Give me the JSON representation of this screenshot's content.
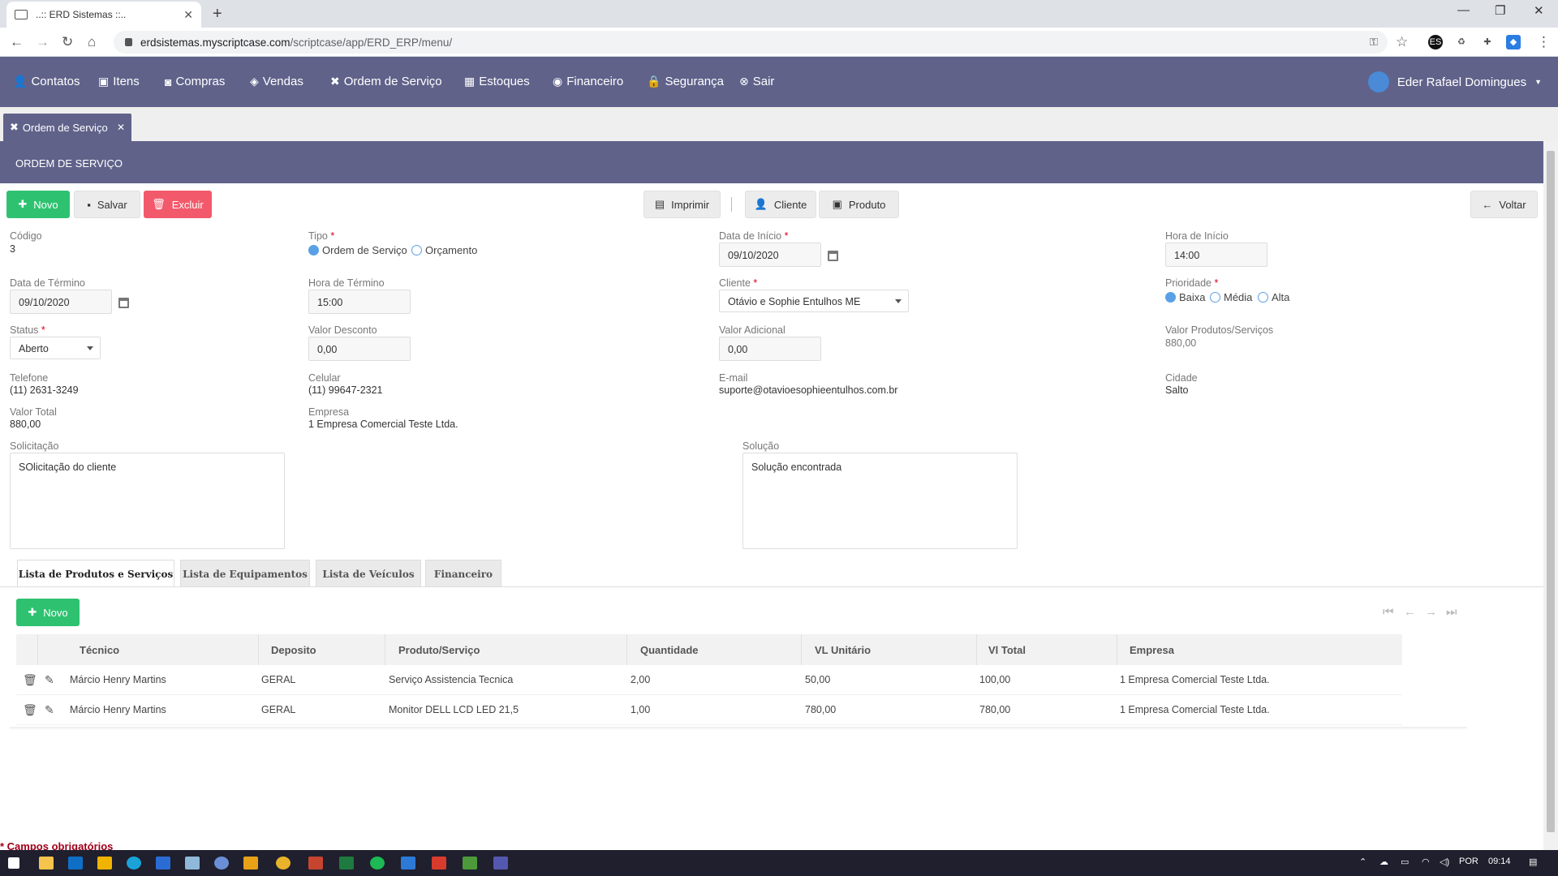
{
  "browser": {
    "tab_title": "..:: ERD Sistemas ::..",
    "url_host": "erdsistemas.myscriptcase.com",
    "url_path": "/scriptcase/app/ERD_ERP/menu/"
  },
  "nav": {
    "items": [
      "Contatos",
      "Itens",
      "Compras",
      "Vendas",
      "Ordem de Serviço",
      "Estoques",
      "Financeiro",
      "Segurança",
      "Sair"
    ],
    "user": "Eder Rafael Domingues"
  },
  "page_tab": {
    "label": "Ordem de Serviço"
  },
  "section_title": "ORDEM DE SERVIÇO",
  "toolbar": {
    "novo": "Novo",
    "salvar": "Salvar",
    "excluir": "Excluir",
    "imprimir": "Imprimir",
    "cliente": "Cliente",
    "produto": "Produto",
    "voltar": "Voltar"
  },
  "form": {
    "codigo_label": "Código",
    "codigo": "3",
    "tipo_label": "Tipo",
    "tipo_options": [
      "Ordem de Serviço",
      "Orçamento"
    ],
    "tipo_selected": "Ordem de Serviço",
    "data_inicio_label": "Data de Início",
    "data_inicio": "09/10/2020",
    "hora_inicio_label": "Hora de Início",
    "hora_inicio": "14:00",
    "data_termino_label": "Data de Término",
    "data_termino": "09/10/2020",
    "hora_termino_label": "Hora de Término",
    "hora_termino": "15:00",
    "cliente_label": "Cliente",
    "cliente": "Otávio e Sophie Entulhos ME",
    "prioridade_label": "Prioridade",
    "prioridade_options": [
      "Baixa",
      "Média",
      "Alta"
    ],
    "prioridade_selected": "Baixa",
    "status_label": "Status",
    "status": "Aberto",
    "valor_desconto_label": "Valor Desconto",
    "valor_desconto": "0,00",
    "valor_adicional_label": "Valor Adicional",
    "valor_adicional": "0,00",
    "valor_produtos_label": "Valor Produtos/Serviços",
    "valor_produtos": "880,00",
    "telefone_label": "Telefone",
    "telefone": "(11) 2631-3249",
    "celular_label": "Celular",
    "celular": "(11) 99647-2321",
    "email_label": "E-mail",
    "email": "suporte@otavioesophieentulhos.com.br",
    "cidade_label": "Cidade",
    "cidade": "Salto",
    "valor_total_label": "Valor Total",
    "valor_total": "880,00",
    "empresa_label": "Empresa",
    "empresa": "1 Empresa Comercial Teste Ltda.",
    "solicitacao_label": "Solicitação",
    "solicitacao": "SOlicitação do cliente",
    "solucao_label": "Solução",
    "solucao": "Solução encontrada"
  },
  "subtabs": [
    "Lista de Produtos e Serviços",
    "Lista de Equipamentos",
    "Lista de Veículos",
    "Financeiro"
  ],
  "grid": {
    "novo": "Novo",
    "headers": [
      "Técnico",
      "Deposito",
      "Produto/Serviço",
      "Quantidade",
      "VL Unitário",
      "Vl Total",
      "Empresa"
    ],
    "rows": [
      [
        "Márcio Henry Martins",
        "GERAL",
        "Serviço Assistencia Tecnica",
        "2,00",
        "50,00",
        "100,00",
        "1 Empresa Comercial Teste Ltda."
      ],
      [
        "Márcio Henry Martins",
        "GERAL",
        "Monitor DELL LCD LED 21,5",
        "1,00",
        "780,00",
        "780,00",
        "1 Empresa Comercial Teste Ltda."
      ]
    ]
  },
  "footer_note": "* Campos obrigatórios",
  "taskbar": {
    "lang": "POR",
    "time": "09:14"
  },
  "colors": {
    "nav_bg": "#60628a",
    "green": "#2ec270",
    "red": "#f25a6b",
    "radio": "#5aa0e6"
  }
}
